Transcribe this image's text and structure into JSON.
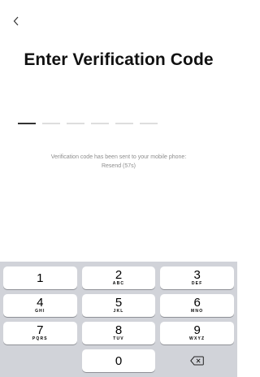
{
  "header": {
    "title": "Enter Verification Code"
  },
  "code_input": {
    "slots": 6,
    "filled": 0
  },
  "info": {
    "sent_message": "Verification code has been sent to your mobile phone:",
    "resend_label": "Resend (57s)"
  },
  "keypad": {
    "rows": [
      [
        {
          "num": "1",
          "sub": ""
        },
        {
          "num": "2",
          "sub": "ABC"
        },
        {
          "num": "3",
          "sub": "DEF"
        }
      ],
      [
        {
          "num": "4",
          "sub": "GHI"
        },
        {
          "num": "5",
          "sub": "JKL"
        },
        {
          "num": "6",
          "sub": "MNO"
        }
      ],
      [
        {
          "num": "7",
          "sub": "PQRS"
        },
        {
          "num": "8",
          "sub": "TUV"
        },
        {
          "num": "9",
          "sub": "WXYZ"
        }
      ]
    ],
    "zero": "0"
  },
  "icons": {
    "back": "chevron-left-icon",
    "delete": "backspace-icon"
  }
}
